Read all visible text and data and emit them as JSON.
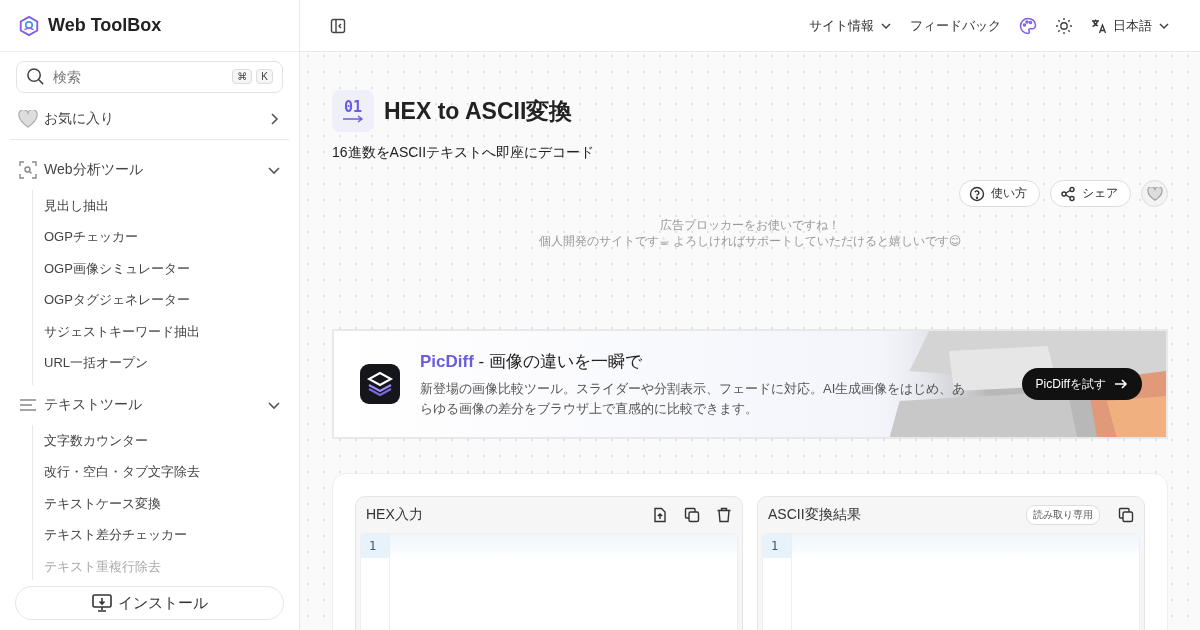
{
  "brand": {
    "name": "Web ToolBox"
  },
  "search": {
    "placeholder": "検索",
    "keys": [
      "⌘",
      "K"
    ]
  },
  "sidebar": {
    "items": [
      {
        "label": "お気に入り",
        "kind": "favorites",
        "expanded": false
      },
      {
        "label": "Web分析ツール",
        "kind": "scan",
        "expanded": true,
        "children": [
          {
            "label": "見出し抽出"
          },
          {
            "label": "OGPチェッカー"
          },
          {
            "label": "OGP画像シミュレーター"
          },
          {
            "label": "OGPタグジェネレーター"
          },
          {
            "label": "サジェストキーワード抽出"
          },
          {
            "label": "URL一括オープン"
          }
        ]
      },
      {
        "label": "テキストツール",
        "kind": "text",
        "expanded": true,
        "children": [
          {
            "label": "文字数カウンター"
          },
          {
            "label": "改行・空白・タブ文字除去"
          },
          {
            "label": "テキストケース変換"
          },
          {
            "label": "テキスト差分チェッカー"
          },
          {
            "label": "テキスト重複行除去"
          }
        ]
      }
    ],
    "install": "インストール"
  },
  "header": {
    "nav": [
      {
        "label": "サイト情報",
        "kind": "menu"
      },
      {
        "label": "フィードバック",
        "kind": "link"
      }
    ],
    "language": "日本語"
  },
  "tool": {
    "icon_text": "01",
    "title": "HEX to ASCII変換",
    "subtitle": "16進数をASCIIテキストへ即座にデコード",
    "actions": [
      {
        "label": "使い方",
        "kind": "help"
      },
      {
        "label": "シェア",
        "kind": "share"
      }
    ],
    "favorite": false
  },
  "notice": [
    "広告ブロッカーをお使いですね！",
    "個人開発のサイトです☕ よろしければサポートしていただけると嬉しいです😊"
  ],
  "banner": {
    "name": "PicDiff",
    "tagline": " - 画像の違いを一瞬で",
    "text": "新登場の画像比較ツール。スライダーや分割表示、フェードに対応。AI生成画像をはじめ、あらゆる画像の差分をブラウザ上で直感的に比較できます。",
    "button": "PicDiffを試す"
  },
  "panels": [
    {
      "title": "HEX入力",
      "tools": [
        {
          "kind": "upload"
        },
        {
          "kind": "copy"
        },
        {
          "kind": "delete"
        }
      ],
      "lines": [
        "1"
      ]
    },
    {
      "title": "ASCII変換結果",
      "badge": "読み取り専用",
      "tools": [
        {
          "kind": "copy"
        }
      ],
      "lines": [
        "1"
      ]
    }
  ]
}
